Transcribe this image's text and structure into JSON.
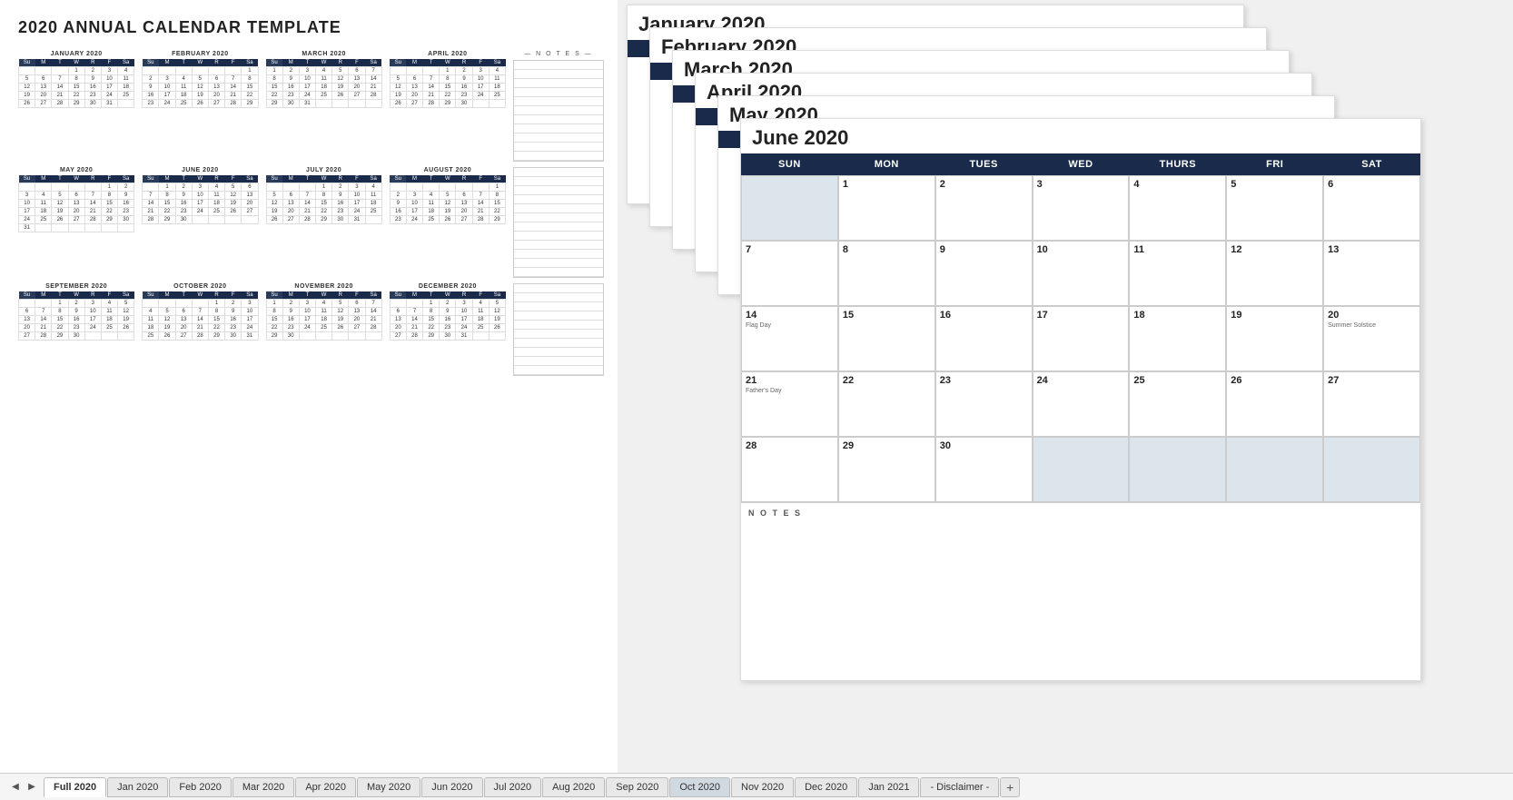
{
  "title": "2020 ANNUAL CALENDAR TEMPLATE",
  "months": {
    "jan": {
      "name": "JANUARY 2020",
      "fullName": "January 2020",
      "headers": [
        "Su",
        "M",
        "T",
        "W",
        "R",
        "F",
        "Sa"
      ],
      "weeks": [
        [
          "",
          "",
          "",
          "1",
          "2",
          "3",
          "4"
        ],
        [
          "5",
          "6",
          "7",
          "8",
          "9",
          "10",
          "11"
        ],
        [
          "12",
          "13",
          "14",
          "15",
          "16",
          "17",
          "18"
        ],
        [
          "19",
          "20",
          "21",
          "22",
          "23",
          "24",
          "25"
        ],
        [
          "26",
          "27",
          "28",
          "29",
          "30",
          "31",
          ""
        ]
      ]
    },
    "feb": {
      "name": "FEBRUARY 2020",
      "fullName": "February 2020",
      "headers": [
        "Su",
        "M",
        "T",
        "W",
        "R",
        "F",
        "Sa"
      ],
      "weeks": [
        [
          "",
          "",
          "",
          "",
          "",
          "",
          "1"
        ],
        [
          "2",
          "3",
          "4",
          "5",
          "6",
          "7",
          "8"
        ],
        [
          "9",
          "10",
          "11",
          "12",
          "13",
          "14",
          "15"
        ],
        [
          "16",
          "17",
          "18",
          "19",
          "20",
          "21",
          "22"
        ],
        [
          "23",
          "24",
          "25",
          "26",
          "27",
          "28",
          "29"
        ]
      ]
    },
    "mar": {
      "name": "MARCH 2020",
      "fullName": "March 2020",
      "headers": [
        "Su",
        "M",
        "T",
        "W",
        "R",
        "F",
        "Sa"
      ],
      "weeks": [
        [
          "1",
          "2",
          "3",
          "4",
          "5",
          "6",
          "7"
        ],
        [
          "8",
          "9",
          "10",
          "11",
          "12",
          "13",
          "14"
        ],
        [
          "15",
          "16",
          "17",
          "18",
          "19",
          "20",
          "21"
        ],
        [
          "22",
          "23",
          "24",
          "25",
          "26",
          "27",
          "28"
        ],
        [
          "29",
          "30",
          "31",
          "",
          "",
          "",
          ""
        ]
      ]
    },
    "apr": {
      "name": "APRIL 2020",
      "fullName": "April 2020",
      "headers": [
        "Su",
        "M",
        "T",
        "W",
        "R",
        "F",
        "Sa"
      ],
      "weeks": [
        [
          "",
          "",
          "",
          "1",
          "2",
          "3",
          "4"
        ],
        [
          "5",
          "6",
          "7",
          "8",
          "9",
          "10",
          "11"
        ],
        [
          "12",
          "13",
          "14",
          "15",
          "16",
          "17",
          "18"
        ],
        [
          "19",
          "20",
          "21",
          "22",
          "23",
          "24",
          "25"
        ],
        [
          "26",
          "27",
          "28",
          "29",
          "30",
          "",
          ""
        ]
      ]
    },
    "may": {
      "name": "MAY 2020",
      "fullName": "May 2020",
      "headers": [
        "Su",
        "M",
        "T",
        "W",
        "R",
        "F",
        "Sa"
      ],
      "weeks": [
        [
          "",
          "",
          "",
          "",
          "",
          "1",
          "2"
        ],
        [
          "3",
          "4",
          "5",
          "6",
          "7",
          "8",
          "9"
        ],
        [
          "10",
          "11",
          "12",
          "13",
          "14",
          "15",
          "16"
        ],
        [
          "17",
          "18",
          "19",
          "20",
          "21",
          "22",
          "23"
        ],
        [
          "24",
          "25",
          "26",
          "27",
          "28",
          "29",
          "30"
        ],
        [
          "31",
          "",
          "",
          "",
          "",
          "",
          ""
        ]
      ]
    },
    "jun": {
      "name": "JUNE 2020",
      "fullName": "June 2020",
      "headers": [
        "SUN",
        "MON",
        "TUES",
        "WED",
        "THURS",
        "FRI",
        "SAT"
      ],
      "weeks": [
        [
          "",
          "1",
          "2",
          "3",
          "4",
          "5",
          "6"
        ],
        [
          "7",
          "8",
          "9",
          "10",
          "11",
          "12",
          "13"
        ],
        [
          "14",
          "15",
          "16",
          "17",
          "18",
          "19",
          "20"
        ],
        [
          "21",
          "22",
          "23",
          "24",
          "25",
          "26",
          "27"
        ],
        [
          "28",
          "29",
          "30",
          "",
          "",
          "",
          ""
        ]
      ],
      "events": {
        "14": "Flag Day",
        "20": "Summer Solstice",
        "21": "Father's Day"
      }
    },
    "jul": {
      "name": "JULY 2020",
      "fullName": "July 2020",
      "headers": [
        "Su",
        "M",
        "T",
        "W",
        "R",
        "F",
        "Sa"
      ],
      "weeks": [
        [
          "",
          "",
          "",
          "1",
          "2",
          "3",
          "4"
        ],
        [
          "5",
          "6",
          "7",
          "8",
          "9",
          "10",
          "11"
        ],
        [
          "12",
          "13",
          "14",
          "15",
          "16",
          "17",
          "18"
        ],
        [
          "19",
          "20",
          "21",
          "22",
          "23",
          "24",
          "25"
        ],
        [
          "26",
          "27",
          "28",
          "29",
          "30",
          "31",
          ""
        ]
      ]
    },
    "aug": {
      "name": "AUGUST 2020",
      "fullName": "August 2020",
      "headers": [
        "Su",
        "M",
        "T",
        "W",
        "R",
        "F",
        "Sa"
      ],
      "weeks": [
        [
          "",
          "",
          "",
          "",
          "",
          "",
          "1"
        ],
        [
          "2",
          "3",
          "4",
          "5",
          "6",
          "7",
          "8"
        ],
        [
          "9",
          "10",
          "11",
          "12",
          "13",
          "14",
          "15"
        ],
        [
          "16",
          "17",
          "18",
          "19",
          "20",
          "21",
          "22"
        ],
        [
          "23",
          "24",
          "25",
          "26",
          "27",
          "28",
          "29"
        ]
      ]
    },
    "sep": {
      "name": "SEPTEMBER 2020",
      "fullName": "September 2020",
      "headers": [
        "Su",
        "M",
        "T",
        "W",
        "R",
        "F",
        "Sa"
      ],
      "weeks": [
        [
          "",
          "",
          "1",
          "2",
          "3",
          "4",
          "5"
        ],
        [
          "6",
          "7",
          "8",
          "9",
          "10",
          "11",
          "12"
        ],
        [
          "13",
          "14",
          "15",
          "16",
          "17",
          "18",
          "19"
        ],
        [
          "20",
          "21",
          "22",
          "23",
          "24",
          "25",
          "26"
        ],
        [
          "27",
          "28",
          "29",
          "30",
          "",
          "",
          ""
        ]
      ]
    },
    "oct": {
      "name": "OCTOBER 2020",
      "fullName": "Oct 2020",
      "headers": [
        "Su",
        "M",
        "T",
        "W",
        "R",
        "F",
        "Sa"
      ],
      "weeks": [
        [
          "",
          "",
          "",
          "",
          "1",
          "2",
          "3"
        ],
        [
          "4",
          "5",
          "6",
          "7",
          "8",
          "9",
          "10"
        ],
        [
          "11",
          "12",
          "13",
          "14",
          "15",
          "16",
          "17"
        ],
        [
          "18",
          "19",
          "20",
          "21",
          "22",
          "23",
          "24"
        ],
        [
          "25",
          "26",
          "27",
          "28",
          "29",
          "30",
          "31"
        ]
      ]
    },
    "nov": {
      "name": "NOVEMBER 2020",
      "fullName": "November 2020",
      "headers": [
        "Su",
        "M",
        "T",
        "W",
        "R",
        "F",
        "Sa"
      ],
      "weeks": [
        [
          "1",
          "2",
          "3",
          "4",
          "5",
          "6",
          "7"
        ],
        [
          "8",
          "9",
          "10",
          "11",
          "12",
          "13",
          "14"
        ],
        [
          "15",
          "16",
          "17",
          "18",
          "19",
          "20",
          "21"
        ],
        [
          "22",
          "23",
          "24",
          "25",
          "26",
          "27",
          "28"
        ],
        [
          "29",
          "30",
          "",
          "",
          "",
          "",
          ""
        ]
      ]
    },
    "dec": {
      "name": "DECEMBER 2020",
      "fullName": "December 2020",
      "headers": [
        "Su",
        "M",
        "T",
        "W",
        "R",
        "F",
        "Sa"
      ],
      "weeks": [
        [
          "",
          "",
          "1",
          "2",
          "3",
          "4",
          "5"
        ],
        [
          "6",
          "7",
          "8",
          "9",
          "10",
          "11",
          "12"
        ],
        [
          "13",
          "14",
          "15",
          "16",
          "17",
          "18",
          "19"
        ],
        [
          "20",
          "21",
          "22",
          "23",
          "24",
          "25",
          "26"
        ],
        [
          "27",
          "28",
          "29",
          "30",
          "31",
          "",
          ""
        ]
      ]
    }
  },
  "tabs": [
    {
      "label": "Full 2020",
      "active": true
    },
    {
      "label": "Jan 2020"
    },
    {
      "label": "Feb 2020"
    },
    {
      "label": "Mar 2020"
    },
    {
      "label": "Apr 2020"
    },
    {
      "label": "May 2020"
    },
    {
      "label": "Jun 2020"
    },
    {
      "label": "Jul 2020"
    },
    {
      "label": "Aug 2020"
    },
    {
      "label": "Sep 2020"
    },
    {
      "label": "Oct 2020",
      "highlighted": true
    },
    {
      "label": "Nov 2020"
    },
    {
      "label": "Dec 2020"
    },
    {
      "label": "Jan 2021"
    },
    {
      "label": "- Disclaimer -"
    }
  ],
  "notes_label": "— N O T E S —"
}
